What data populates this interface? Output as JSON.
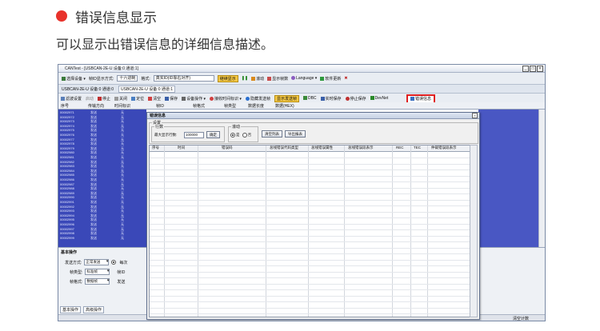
{
  "doc": {
    "heading": "错误信息显示",
    "subtitle": "可以显示出错误信息的详细信息描述。"
  },
  "app": {
    "window_title": "CANTest - [USBCAN-2E-U 设备:0 通道:1]",
    "window_controls": [
      "_",
      "□",
      "×"
    ],
    "toolbar1": {
      "select_device": "选择设备",
      "frame_id_format_label": "帧ID显示方式:",
      "frame_id_format_value": "十六进制",
      "mode_label": "格式:",
      "mode_value": "真实ID(ID靠右对齐)",
      "continue_display": "继续显示",
      "scroll": "滚动",
      "display_frames": "显示帧数",
      "language": "Language",
      "software_update": "软件更新"
    },
    "tab_label": "USBCAN-2E-U 设备:0 通道:0",
    "tab_label2": "USBCAN-2E-U 设备:0 通道:1",
    "toolbar3": {
      "filter": "滤波设置",
      "start": "启动",
      "stop": "停止",
      "close": "关闭",
      "locate": "定位",
      "clear": "清空",
      "save": "保存",
      "device_ops": "设备操作",
      "receive_time": "接收时间标识",
      "hide_send": "隐藏发送帧",
      "show_send": "显示发送帧",
      "dbc": "DBC",
      "realtime_save": "实时保存",
      "stop_save": "停止保存",
      "devnet": "DevNet",
      "error_info": "错误信息"
    },
    "columns": [
      "序号",
      "传输方向",
      "时间标识",
      "帧ID",
      "帧格式",
      "帧类型",
      "数据长度",
      "数据(HEX)"
    ],
    "rows": [
      {
        "id": "00002971",
        "dir": "发送",
        "time": "无"
      },
      {
        "id": "00002972",
        "dir": "发送",
        "time": "无"
      },
      {
        "id": "00002973",
        "dir": "发送",
        "time": "无"
      },
      {
        "id": "00002974",
        "dir": "发送",
        "time": "无"
      },
      {
        "id": "00002975",
        "dir": "发送",
        "time": "无"
      },
      {
        "id": "00002976",
        "dir": "发送",
        "time": "无"
      },
      {
        "id": "00002977",
        "dir": "发送",
        "time": "无"
      },
      {
        "id": "00002978",
        "dir": "发送",
        "time": "无"
      },
      {
        "id": "00002979",
        "dir": "发送",
        "time": "无"
      },
      {
        "id": "00002980",
        "dir": "发送",
        "time": "无"
      },
      {
        "id": "00002981",
        "dir": "发送",
        "time": "无"
      },
      {
        "id": "00002982",
        "dir": "发送",
        "time": "无"
      },
      {
        "id": "00002983",
        "dir": "发送",
        "time": "无"
      },
      {
        "id": "00002984",
        "dir": "发送",
        "time": "无"
      },
      {
        "id": "00002985",
        "dir": "发送",
        "time": "无"
      },
      {
        "id": "00002986",
        "dir": "发送",
        "time": "无"
      },
      {
        "id": "00002987",
        "dir": "发送",
        "time": "无"
      },
      {
        "id": "00002988",
        "dir": "发送",
        "time": "无"
      },
      {
        "id": "00002989",
        "dir": "发送",
        "time": "无"
      },
      {
        "id": "00002990",
        "dir": "发送",
        "time": "无"
      },
      {
        "id": "00002991",
        "dir": "发送",
        "time": "无"
      },
      {
        "id": "00002992",
        "dir": "发送",
        "time": "无"
      },
      {
        "id": "00002993",
        "dir": "发送",
        "time": "无"
      },
      {
        "id": "00002994",
        "dir": "发送",
        "time": "无"
      },
      {
        "id": "00002995",
        "dir": "发送",
        "time": "无"
      },
      {
        "id": "00002996",
        "dir": "发送",
        "time": "无"
      },
      {
        "id": "00002997",
        "dir": "发送",
        "time": "无"
      },
      {
        "id": "00002998",
        "dir": "发送",
        "time": "无"
      },
      {
        "id": "00002999",
        "dir": "发送",
        "time": "无"
      }
    ],
    "basic_ops": {
      "title": "基本操作",
      "send_mode_label": "发送方式:",
      "send_mode_value": "正常发送",
      "per_send_label": "每次",
      "frame_type_label": "帧类型:",
      "frame_type_value": "标准帧",
      "frame_id_short": "帧ID",
      "frame_format_label": "帧格式:",
      "frame_format_value": "数据帧",
      "send_label": "发送"
    },
    "bottom_tabs": [
      "基本操作",
      "高级操作"
    ],
    "status_text": "清空计数"
  },
  "dialog": {
    "title": "错误信息",
    "settings_group": "设置",
    "rows_group": "行数",
    "max_rows_label": "最大显示行数:",
    "max_rows_value": "100000",
    "ok_button": "确定",
    "scroll_group": "滚动",
    "scroll_yes": "是",
    "scroll_no": "否",
    "clear_list": "清空列表",
    "export_report": "导出报表",
    "columns": [
      "序号",
      "时间",
      "错误码",
      "总线错误代码类型",
      "总线错误属性",
      "总线错误段表示",
      "REC",
      "TEC",
      "仲裁错误段表示"
    ]
  },
  "colors": {
    "grid_blue": "#3a48b8",
    "highlight_red": "#e02020",
    "bullet_red": "#e8322b"
  }
}
